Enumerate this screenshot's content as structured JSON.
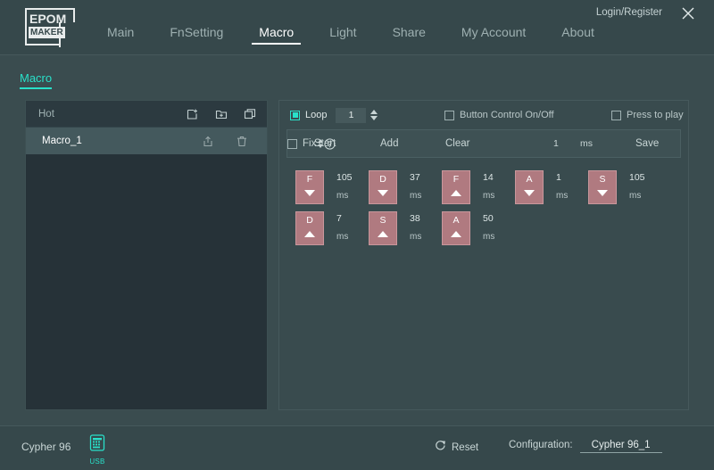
{
  "window": {
    "logo_top": "EPOM",
    "logo_bottom": "MAKER",
    "login_label": "Login/Register",
    "close_icon": "close-icon"
  },
  "nav": {
    "items": [
      {
        "label": "Main",
        "active": false
      },
      {
        "label": "FnSetting",
        "active": false
      },
      {
        "label": "Macro",
        "active": true
      },
      {
        "label": "Light",
        "active": false
      },
      {
        "label": "Share",
        "active": false
      },
      {
        "label": "My Account",
        "active": false
      },
      {
        "label": "About",
        "active": false
      }
    ]
  },
  "page": {
    "title": "Macro"
  },
  "left_panel": {
    "header_label": "Hot",
    "header_icons": [
      "new-file-icon",
      "new-folder-icon",
      "duplicate-icon"
    ],
    "items": [
      {
        "label": "Macro_1",
        "selected": true,
        "icons": [
          "export-icon",
          "delete-icon"
        ]
      }
    ]
  },
  "options": {
    "loop": {
      "label": "Loop",
      "checked": true,
      "value": "1"
    },
    "button_control": {
      "label": "Button Control On/Off",
      "checked": false
    },
    "press_to_play": {
      "label": "Press to play",
      "checked": false
    }
  },
  "actions": {
    "start": "Start",
    "add": "Add",
    "clear": "Clear",
    "fix": {
      "label": "Fix",
      "checked": false
    },
    "fix_value": "1",
    "fix_unit": "ms",
    "save": "Save",
    "help_icon": "help-icon"
  },
  "sequence": {
    "unit": "ms",
    "steps": [
      {
        "key": "F",
        "dir": "down",
        "delay": "105"
      },
      {
        "key": "D",
        "dir": "down",
        "delay": "37"
      },
      {
        "key": "F",
        "dir": "up",
        "delay": "14"
      },
      {
        "key": "A",
        "dir": "down",
        "delay": "1"
      },
      {
        "key": "S",
        "dir": "down",
        "delay": "105"
      },
      {
        "key": "D",
        "dir": "up",
        "delay": "7"
      },
      {
        "key": "S",
        "dir": "up",
        "delay": "38"
      },
      {
        "key": "A",
        "dir": "up",
        "delay": "50"
      }
    ]
  },
  "footer": {
    "device_name": "Cypher 96",
    "connection_icon": "keyboard-icon",
    "connection_label": "USB",
    "reset_label": "Reset",
    "reset_icon": "refresh-icon",
    "configuration_label": "Configuration:",
    "configuration_value": "Cypher 96_1"
  },
  "colors": {
    "background": "#3a4c4f",
    "panel_dark": "#263238",
    "accent": "#29e0c9",
    "key": "#b07a80",
    "key_border": "#c9979c"
  }
}
